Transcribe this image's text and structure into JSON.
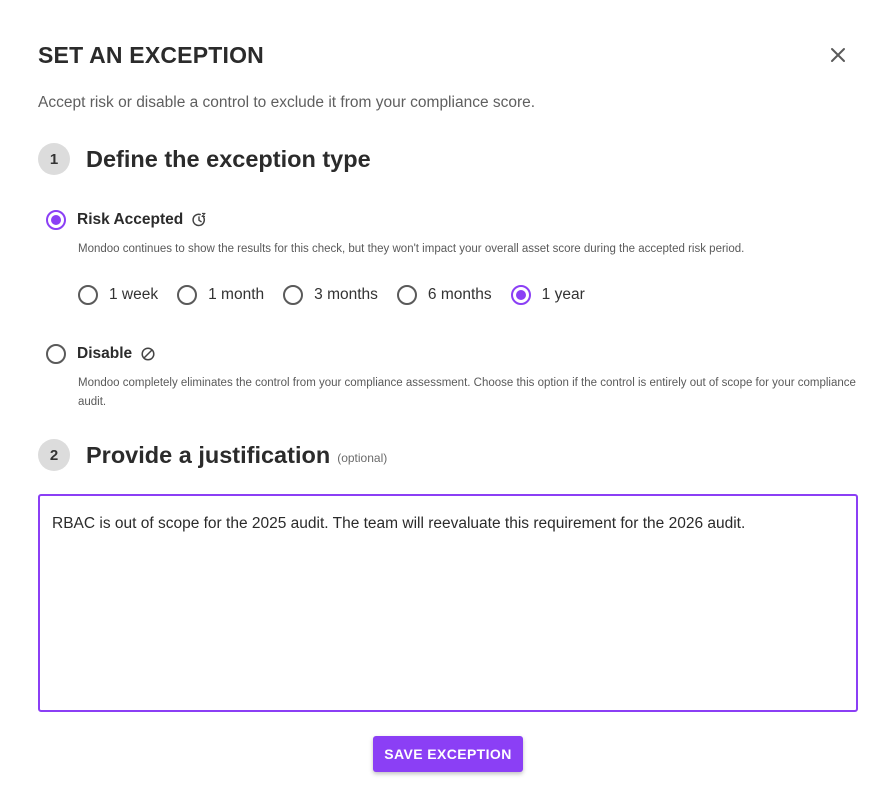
{
  "dialog": {
    "title": "SET AN EXCEPTION",
    "subtitle": "Accept risk or disable a control to exclude it from your compliance score.",
    "close_icon": "close-icon"
  },
  "step1": {
    "number": "1",
    "title": "Define the exception type",
    "options": [
      {
        "label": "Risk Accepted",
        "icon": "snooze-clock-icon",
        "checked": true,
        "description": "Mondoo continues to show the results for this check, but they won't impact your overall asset score during the accepted risk period."
      },
      {
        "label": "Disable",
        "icon": "block-icon",
        "checked": false,
        "description": "Mondoo completely eliminates the control from your compliance assessment. Choose this option if the control is entirely out of scope for your compliance audit."
      }
    ],
    "durations": [
      {
        "label": "1 week",
        "checked": false
      },
      {
        "label": "1 month",
        "checked": false
      },
      {
        "label": "3 months",
        "checked": false
      },
      {
        "label": "6 months",
        "checked": false
      },
      {
        "label": "1 year",
        "checked": true
      }
    ]
  },
  "step2": {
    "number": "2",
    "title": "Provide a justification",
    "optional": "(optional)",
    "value": "RBAC is out of scope for the 2025 audit. The team will reevaluate this requirement for the 2026 audit."
  },
  "actions": {
    "save_label": "SAVE EXCEPTION"
  },
  "colors": {
    "accent": "#8b3ff5",
    "step_badge": "#dcdcdc"
  }
}
